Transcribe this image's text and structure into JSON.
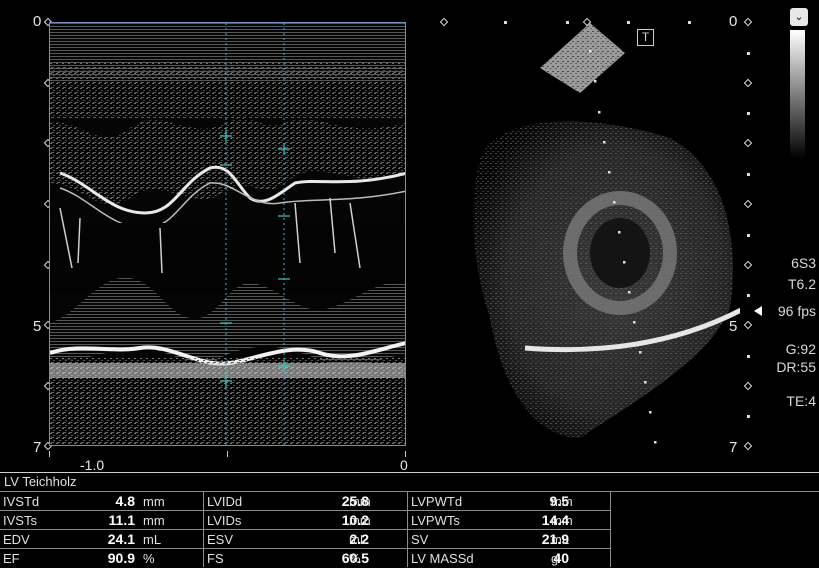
{
  "mmode": {
    "depth_top": "0",
    "depth_mid": "5",
    "depth_bottom": "7",
    "time_left": "-1.0",
    "time_right": "0"
  },
  "sector": {
    "depth_top": "0",
    "depth_mid": "5",
    "depth_bottom": "7",
    "trace_icon": "T"
  },
  "info": {
    "probe": "6S3",
    "preset": "T6.2",
    "fps": "96 fps",
    "gain": "G:92",
    "dynamic_range": "DR:55",
    "te": "TE:4"
  },
  "icons": {
    "menu": "chevron-down-icon",
    "grayscale": "grayscale-bar-icon",
    "trace": "trace-icon",
    "fps_marker": "caret-left-icon"
  },
  "table": {
    "title": "LV Teichholz",
    "rows": [
      [
        {
          "label": "IVSTd",
          "value": "4.8",
          "unit": "mm"
        },
        {
          "label": "LVIDd",
          "value": "25.8",
          "unit": "mm"
        },
        {
          "label": "LVPWTd",
          "value": "9.5",
          "unit": "mm"
        }
      ],
      [
        {
          "label": "IVSTs",
          "value": "11.1",
          "unit": "mm"
        },
        {
          "label": "LVIDs",
          "value": "10.2",
          "unit": "mm"
        },
        {
          "label": "LVPWTs",
          "value": "14.4",
          "unit": "mm"
        }
      ],
      [
        {
          "label": "EDV",
          "value": "24.1",
          "unit": "mL"
        },
        {
          "label": "ESV",
          "value": "2.2",
          "unit": "mL"
        },
        {
          "label": "SV",
          "value": "21.9",
          "unit": "mL"
        }
      ],
      [
        {
          "label": "EF",
          "value": "90.9",
          "unit": "%"
        },
        {
          "label": "FS",
          "value": "60.5",
          "unit": "%"
        },
        {
          "label": "LV MASSd",
          "value": "40",
          "unit": "g"
        }
      ]
    ]
  }
}
